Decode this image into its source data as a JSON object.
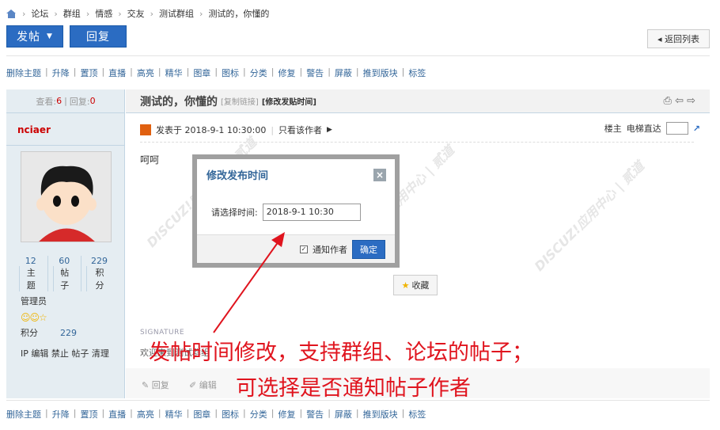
{
  "breadcrumb": {
    "items": [
      "论坛",
      "群组",
      "情感",
      "交友",
      "测试群组",
      "测试的，你懂的"
    ]
  },
  "buttons": {
    "post": "发帖",
    "reply": "回复",
    "back": "◂ 返回列表"
  },
  "modbar": [
    "删除主题",
    "升降",
    "置顶",
    "直播",
    "高亮",
    "精华",
    "图章",
    "图标",
    "分类",
    "修复",
    "警告",
    "屏蔽",
    "推到版块",
    "标签"
  ],
  "thread": {
    "views_label": "查看:",
    "views": "6",
    "replies_label": "回复:",
    "replies": "0",
    "title": "测试的，你懂的",
    "copy_link": "[复制链接]",
    "edit_time": "[修改发贴时间]"
  },
  "author": {
    "name": "nciaer",
    "stats": [
      {
        "num": "12",
        "label": "主题"
      },
      {
        "num": "60",
        "label": "帖子"
      },
      {
        "num": "229",
        "label": "积分"
      }
    ],
    "group": "管理员",
    "credits_label": "积分",
    "credits": "229",
    "actions": "IP 编辑 禁止 帖子 清理"
  },
  "post": {
    "meta": "发表于 2018-9-1 10:30:00",
    "only_author": "只看该作者",
    "floor": "楼主",
    "jump": "电梯直达",
    "content": "呵呵",
    "favorite": "收藏",
    "signature_label": "SIGNATURE",
    "signature": "欢迎来到测试群组",
    "reply": "回复",
    "edit": "编辑"
  },
  "dialog": {
    "title": "修改发布时间",
    "close": "×",
    "label": "请选择时间:",
    "value": "2018-9-1 10:30",
    "notify": "通知作者",
    "confirm": "确定"
  },
  "annotation": {
    "line1": "发帖时间修改，支持群组、论坛的帖子；",
    "line2": "可选择是否通知帖子作者"
  },
  "colors": {
    "accent": "#2b6cc2",
    "annotation": "#e0141e"
  }
}
